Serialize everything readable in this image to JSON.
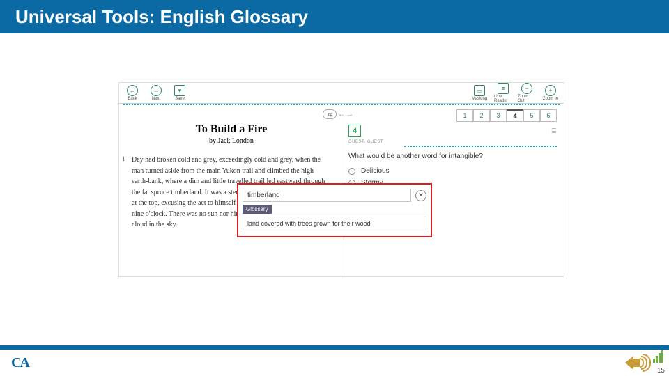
{
  "slide": {
    "title": "Universal Tools: English Glossary",
    "page_number": "15"
  },
  "app": {
    "toolbar": {
      "back": "Back",
      "next": "Next",
      "save": "Save",
      "masking": "Masking",
      "line_reader": "Line Reader",
      "zoom_out": "Zoom Out",
      "zoom_in": "Zoom In"
    },
    "passage": {
      "title": "To Build a Fire",
      "byline": "by Jack London",
      "para_num": "1",
      "para_text": "Day had broken cold and grey, exceedingly cold and grey, when the man turned aside from the main Yukon trail and climbed the high earth-bank, where a dim and little travelled trail led eastward through the fat spruce timberland. It was a steep bank, and he paused for breath at the top, excusing the act to himself by looking at his watch. It was nine o'clock. There was no sun nor hint of sun, though there was not a cloud in the sky."
    },
    "question": {
      "tabs": [
        "1",
        "2",
        "3",
        "4",
        "5",
        "6"
      ],
      "active_tab": "4",
      "number": "4",
      "meta": "GUEST, GUEST",
      "prompt": "What would be another word for intangible?",
      "choices": [
        "Delicious",
        "Stormy"
      ]
    },
    "glossary": {
      "word": "timberland",
      "label": "Glossary",
      "definition": "land covered with trees grown for their wood"
    }
  },
  "footer": {
    "logo": "CA"
  }
}
